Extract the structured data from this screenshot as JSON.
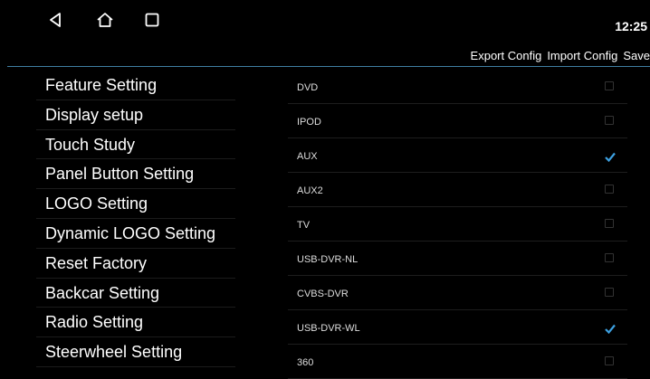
{
  "statusbar": {
    "time": "12:25"
  },
  "actions": [
    "Export Config",
    "Import Config",
    "Save"
  ],
  "sidebar": {
    "items": [
      {
        "label": "Feature Setting"
      },
      {
        "label": "Display setup"
      },
      {
        "label": "Touch Study"
      },
      {
        "label": "Panel Button Setting"
      },
      {
        "label": "LOGO Setting"
      },
      {
        "label": "Dynamic LOGO Setting"
      },
      {
        "label": "Reset Factory"
      },
      {
        "label": "Backcar Setting"
      },
      {
        "label": "Radio Setting"
      },
      {
        "label": "Steerwheel Setting"
      }
    ]
  },
  "features": [
    {
      "label": "DVD",
      "checked": false
    },
    {
      "label": "IPOD",
      "checked": false
    },
    {
      "label": "AUX",
      "checked": true
    },
    {
      "label": "AUX2",
      "checked": false
    },
    {
      "label": "TV",
      "checked": false
    },
    {
      "label": "USB-DVR-NL",
      "checked": false
    },
    {
      "label": "CVBS-DVR",
      "checked": false
    },
    {
      "label": "USB-DVR-WL",
      "checked": true
    },
    {
      "label": "360",
      "checked": false
    }
  ],
  "colors": {
    "accent": "#3da0e0",
    "divider": "#3f7ea3"
  }
}
